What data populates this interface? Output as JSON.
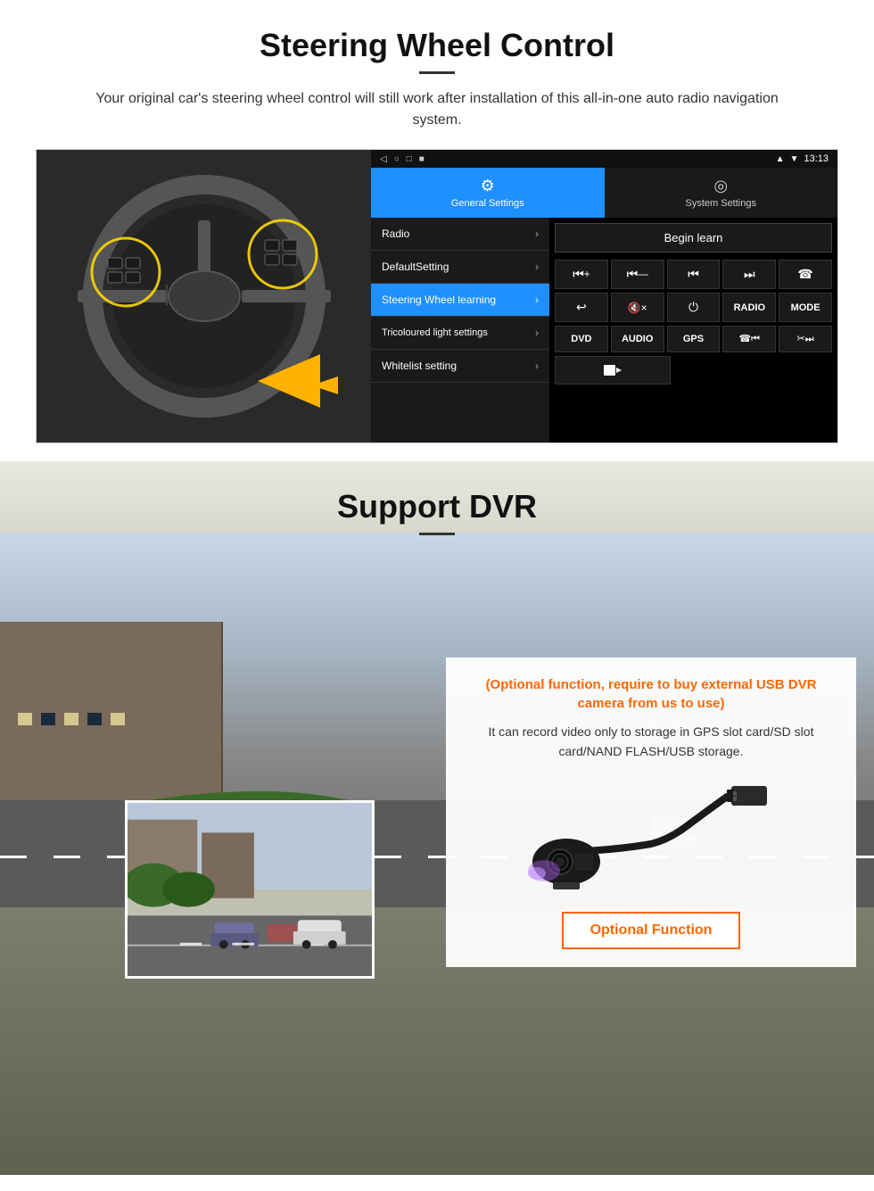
{
  "page": {
    "steering_section": {
      "title": "Steering Wheel Control",
      "subtitle": "Your original car's steering wheel control will still work after installation of this all-in-one auto radio navigation system.",
      "statusbar": {
        "time": "13:13",
        "icons": [
          "◁",
          "○",
          "□",
          "■"
        ]
      },
      "tabs": {
        "general": {
          "label": "General Settings",
          "icon": "⚙"
        },
        "system": {
          "label": "System Settings",
          "icon": "🌐"
        }
      },
      "menu_items": [
        {
          "label": "Radio",
          "active": false
        },
        {
          "label": "DefaultSetting",
          "active": false
        },
        {
          "label": "Steering Wheel learning",
          "active": true
        },
        {
          "label": "Tricoloured light settings",
          "active": false
        },
        {
          "label": "Whitelist setting",
          "active": false
        }
      ],
      "begin_learn_label": "Begin learn",
      "control_buttons_row1": [
        "⏮+",
        "⏮—",
        "⏮⏭",
        "⏭⏭",
        "☎"
      ],
      "control_buttons_row2": [
        "↩",
        "🔇×",
        "⏻",
        "RADIO",
        "MODE"
      ],
      "control_buttons_row3": [
        "DVD",
        "AUDIO",
        "GPS",
        "☎⏮",
        "✂⏭"
      ],
      "control_buttons_row4": [
        "🎬"
      ]
    },
    "dvr_section": {
      "title": "Support DVR",
      "optional_text": "(Optional function, require to buy external USB DVR camera from us to use)",
      "description": "It can record video only to storage in GPS slot card/SD slot card/NAND FLASH/USB storage.",
      "optional_function_label": "Optional Function"
    }
  }
}
